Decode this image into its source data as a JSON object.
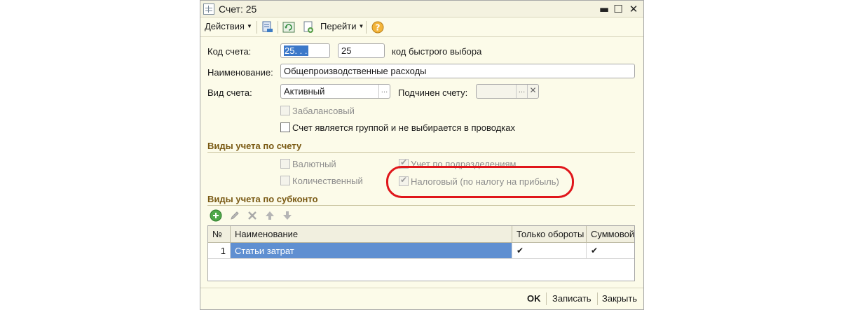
{
  "window": {
    "title": "Счет: 25",
    "controls": {
      "minimize": "▬",
      "maximize": "☐",
      "close": "✕"
    }
  },
  "toolbar": {
    "actions_label": "Действия",
    "goto_label": "Перейти",
    "icons": [
      "save-to-list-icon",
      "refresh-icon",
      "copy-icon",
      "help-icon"
    ]
  },
  "form": {
    "code_label": "Код счета:",
    "code_value": "25. . .",
    "quick_code_value": "25",
    "quick_code_label": "код быстрого выбора",
    "name_label": "Наименование:",
    "name_value": "Общепроизводственные расходы",
    "type_label": "Вид счета:",
    "type_value": "Активный",
    "parent_label": "Подчинен счету:",
    "parent_value": "",
    "offbalance_label": "Забалансовый",
    "offbalance_checked": false,
    "group_label": "Счет является группой и не выбирается в проводках",
    "group_checked": false
  },
  "accounting_types": {
    "section_title": "Виды учета по счету",
    "currency_label": "Валютный",
    "currency_checked": false,
    "quantity_label": "Количественный",
    "quantity_checked": false,
    "departments_label": "Учет по подразделениям",
    "departments_checked": true,
    "tax_label": "Налоговый (по налогу на прибыль)",
    "tax_checked": true,
    "highlight_color": "#e0161b"
  },
  "subconto": {
    "section_title": "Виды учета по субконто",
    "toolbar_icons": [
      "add-icon",
      "edit-icon",
      "delete-icon",
      "move-up-icon",
      "move-down-icon"
    ],
    "columns": [
      "№",
      "Наименование",
      "Только обороты",
      "Суммовой"
    ],
    "rows": [
      {
        "num": "1",
        "name": "Статьи затрат",
        "turnover_only": "✔",
        "sum": "✔"
      }
    ]
  },
  "footer": {
    "ok_label": "OK",
    "save_label": "Записать",
    "close_label": "Закрыть"
  },
  "colors": {
    "window_bg": "#fcfbe9",
    "section_title": "#7a5a14",
    "selection": "#5f8fd1"
  }
}
